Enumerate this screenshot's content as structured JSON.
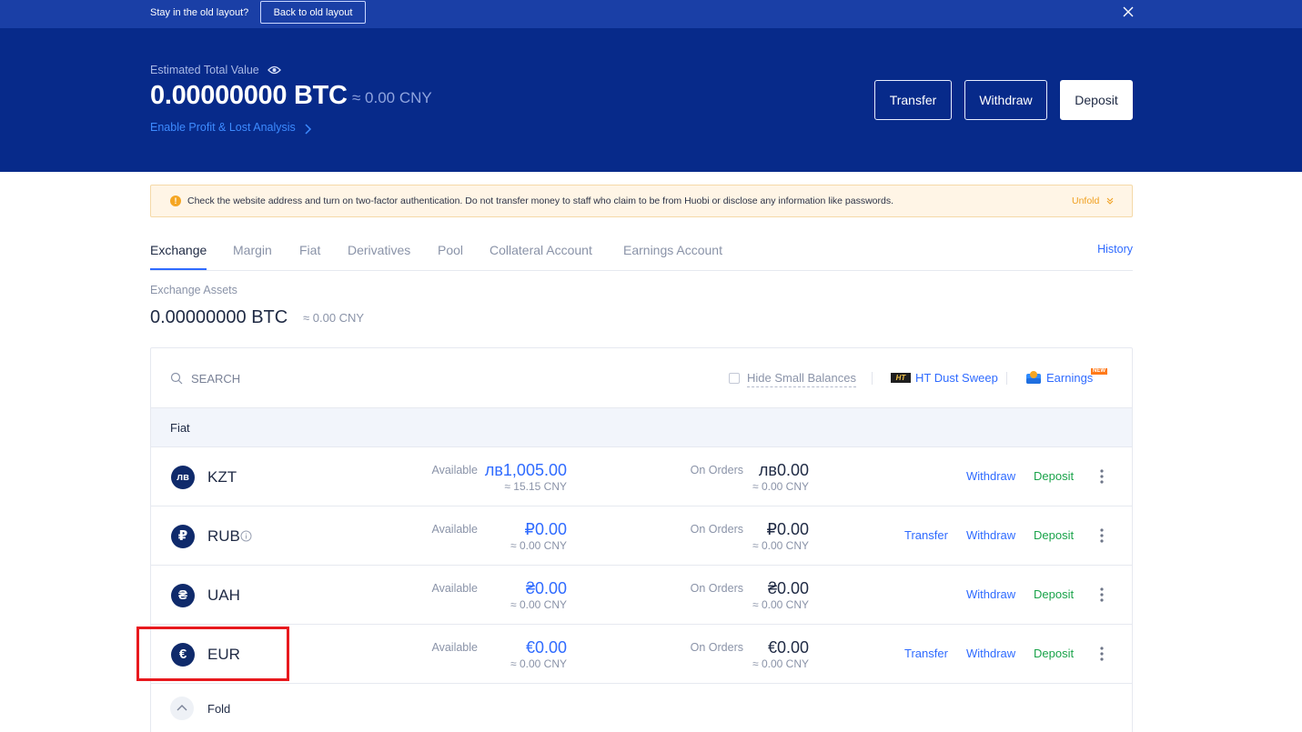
{
  "topbar": {
    "message": "Stay in the old layout?",
    "back_button": "Back to old layout"
  },
  "hero": {
    "estimated_label": "Estimated Total Value",
    "total_btc": "0.00000000 BTC",
    "total_cny": "≈ 0.00 CNY",
    "pnl_link": "Enable Profit & Lost Analysis",
    "buttons": {
      "transfer": "Transfer",
      "withdraw": "Withdraw",
      "deposit": "Deposit"
    }
  },
  "warning": {
    "text": "Check the website address and turn on two-factor authentication. Do not transfer money to staff who claim to be from Huobi or disclose any information like passwords.",
    "unfold": "Unfold"
  },
  "tabs": {
    "items": [
      "Exchange",
      "Margin",
      "Fiat",
      "Derivatives",
      "Pool",
      "Collateral Account",
      "Earnings Account"
    ],
    "active": "Exchange",
    "history": "History"
  },
  "exchange": {
    "label": "Exchange Assets",
    "total_btc": "0.00000000 BTC",
    "total_cny": "≈ 0.00 CNY"
  },
  "toolbar": {
    "search_placeholder": "SEARCH",
    "hide_small": "Hide Small Balances",
    "ht_icon_text": "HT",
    "dust_sweep": "HT Dust Sweep",
    "earnings": "Earnings",
    "new_badge": "NEW"
  },
  "fiat_section": {
    "title": "Fiat"
  },
  "labels": {
    "available": "Available",
    "on_orders": "On Orders",
    "transfer": "Transfer",
    "withdraw": "Withdraw",
    "deposit": "Deposit"
  },
  "assets": [
    {
      "symbol": "KZT",
      "icon": "лв",
      "available": "лв1,005.00",
      "available_cny": "≈ 15.15 CNY",
      "on_orders": "лв0.00",
      "on_orders_cny": "≈ 0.00 CNY",
      "has_transfer": false,
      "has_info": false
    },
    {
      "symbol": "RUB",
      "icon": "₽",
      "available": "₽0.00",
      "available_cny": "≈ 0.00 CNY",
      "on_orders": "₽0.00",
      "on_orders_cny": "≈ 0.00 CNY",
      "has_transfer": true,
      "has_info": true
    },
    {
      "symbol": "UAH",
      "icon": "₴",
      "available": "₴0.00",
      "available_cny": "≈ 0.00 CNY",
      "on_orders": "₴0.00",
      "on_orders_cny": "≈ 0.00 CNY",
      "has_transfer": false,
      "has_info": false
    },
    {
      "symbol": "EUR",
      "icon": "€",
      "available": "€0.00",
      "available_cny": "≈ 0.00 CNY",
      "on_orders": "€0.00",
      "on_orders_cny": "≈ 0.00 CNY",
      "has_transfer": true,
      "has_info": false
    }
  ],
  "fold": {
    "label": "Fold"
  },
  "colors": {
    "hero_bg": "#072a8a",
    "accent": "#2f6bff",
    "deposit_green": "#1aa34a",
    "highlight": "#e8191e"
  }
}
